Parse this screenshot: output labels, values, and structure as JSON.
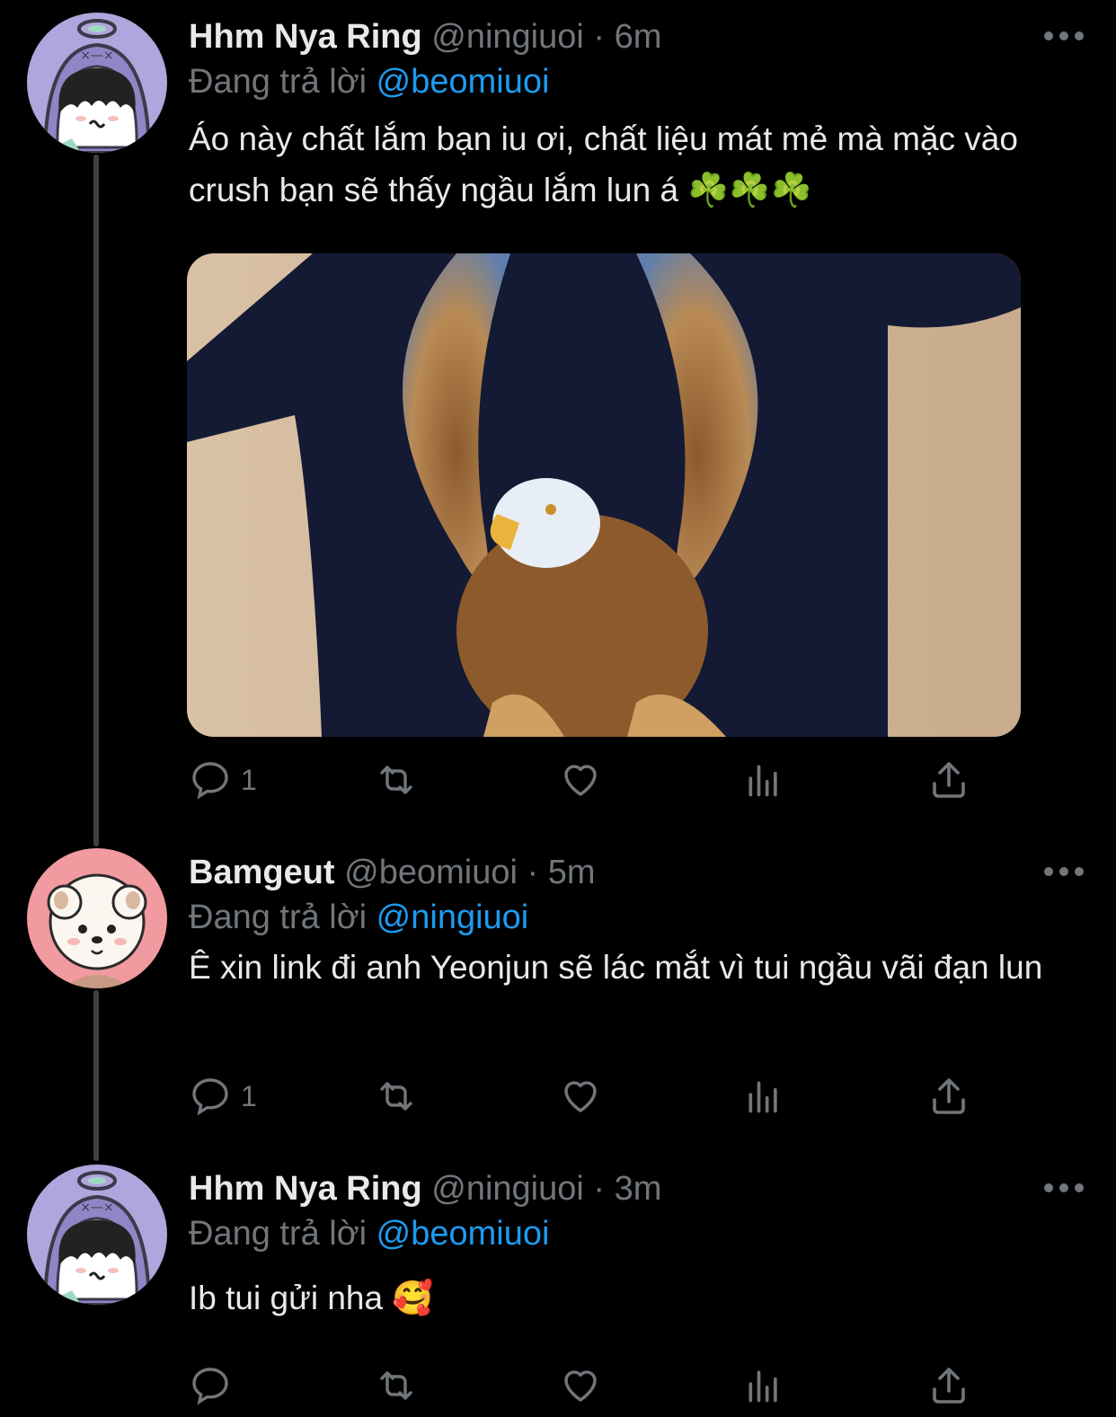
{
  "colors": {
    "background": "#000000",
    "text": "#e7e9ea",
    "muted": "#71767b",
    "link": "#1d9bf0",
    "thread_line": "#3e4144"
  },
  "tweets": [
    {
      "name": "Hhm Nya Ring",
      "handle": "@ningiuoi",
      "separator": "·",
      "time": "6m",
      "reply_prefix": "Đang trả lời",
      "reply_to": "@beomiuoi",
      "text": "Áo này chất lắm bạn iu ơi, chất liệu mát mẻ mà mặc vào crush bạn sẽ thấy ngầu lắm lun á ☘️☘️☘️",
      "media": "eagle-tshirt-photo",
      "reply_count": "1",
      "avatar": "purple-hooded-character-avatar"
    },
    {
      "name": "Bamgeut",
      "handle": "@beomiuoi",
      "separator": "·",
      "time": "5m",
      "reply_prefix": "Đang trả lời",
      "reply_to": "@ningiuoi",
      "text": "Ê xin link đi anh Yeonjun sẽ lác mắt vì tui ngầu vãi đạn lun",
      "reply_count": "1",
      "avatar": "pink-puppy-character-avatar"
    },
    {
      "name": "Hhm Nya Ring",
      "handle": "@ningiuoi",
      "separator": "·",
      "time": "3m",
      "reply_prefix": "Đang trả lời",
      "reply_to": "@beomiuoi",
      "text": "Ib tui gửi nha 🥰",
      "reply_count": "",
      "avatar": "purple-hooded-character-avatar"
    }
  ],
  "icons": [
    "more-icon",
    "reply-icon",
    "retweet-icon",
    "like-icon",
    "views-icon",
    "share-icon"
  ]
}
